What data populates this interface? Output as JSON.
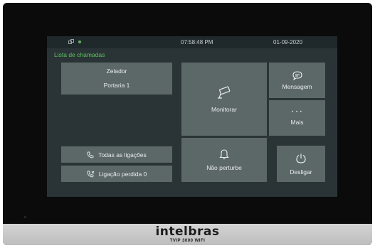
{
  "status": {
    "time": "07:58:48   PM",
    "date": "01-09-2020"
  },
  "call_list": {
    "title": "Lista de chamadas",
    "contacts": [
      "Zelador",
      "Portaria 1"
    ],
    "all_calls": "Todas as ligações",
    "missed_calls": "Ligação perdida 0"
  },
  "buttons": {
    "monitor": "Monitorar",
    "message": "Mensagem",
    "more": "Mais",
    "more_glyph": "• • •",
    "dnd": "Não perturbe",
    "power": "Desligar"
  },
  "device": {
    "brand": "intelbras",
    "model": "TVIP 3000 WIFI"
  },
  "icons": [
    "network-icon",
    "camera-icon",
    "chat-icon",
    "bell-icon",
    "power-icon",
    "phone-icon",
    "missed-call-icon"
  ],
  "colors": {
    "screen_bg": "#2a3436",
    "tile": "#5c6768",
    "accent_green": "#5cc060"
  }
}
